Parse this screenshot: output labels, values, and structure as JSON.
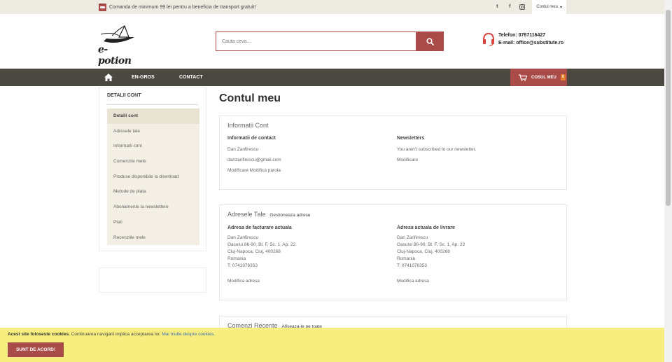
{
  "topbar": {
    "promo_text": "Comanda de minimum 99 lei pentru a beneficia de transport gratuit!",
    "social": [
      "twitter-icon",
      "facebook-icon",
      "instagram-icon"
    ],
    "account_label": "Contul meu"
  },
  "header": {
    "logo_text": "e-potion",
    "search_placeholder": "Cauta ceva...",
    "phone": "Telefon: 0767116427",
    "email": "E-mail: office@substitute.ro"
  },
  "nav": {
    "items": [
      "EN-GROS",
      "CONTACT"
    ],
    "cart_label": "COSUL MEU",
    "cart_count": "0"
  },
  "sidebar": {
    "title": "DETALII CONT",
    "items": [
      "Detalii cont",
      "Adresele tale",
      "Informatii cont",
      "Comenzile mele",
      "Produse disponibile la download",
      "Metode de plata",
      "Abonamente la newslettere",
      "Plati",
      "Recenziile mele"
    ]
  },
  "main": {
    "title": "Contul meu",
    "info": {
      "heading": "Informatii Cont",
      "contact_heading": "Informatii de contact",
      "name": "Dan Zanfirescu",
      "email": "danzanfirescu@gmail.com",
      "edit_links": "Modificare Modifica parola",
      "newsletter_heading": "Newsletters",
      "newsletter_text": "You aren't subscribed to our newsletter.",
      "newsletter_edit": "Modificare"
    },
    "addresses": {
      "heading": "Adresele Tale",
      "manage": "Gestioneaza adrese",
      "billing_heading": "Adresa de facturare actuala",
      "shipping_heading": "Adresa actuala de livrare",
      "billing": [
        "Dan Zanfirescu",
        "Oasului 86-90, Bl. F, Sc. 1, Ap. 22",
        "Cluj-Napoca, Cluj, 400268",
        "Romania",
        "T: 0741076353"
      ],
      "shipping": [
        "Dan Zanfirescu",
        "Oasului 86-90, Bl. F, Sc. 1, Ap. 22",
        "Cluj-Napoca, Cluj, 400268",
        "Romania",
        "T: 0741076353"
      ],
      "billing_edit": "Modifica adresa",
      "shipping_edit": "Modifica adresa"
    },
    "orders": {
      "heading": "Comenzi Recente",
      "view_all": "Afiseaza-le pe toate"
    }
  },
  "cookie": {
    "bold": "Acest site foloseste cookies.",
    "text": " Continuarea navigarii implica acceptarea lor.",
    "link": "Mai multe despre cookies.",
    "button": "SUNT DE ACORD!"
  },
  "colors": {
    "accent": "#a94c49",
    "nav_bg": "#4a4841",
    "topbar_bg": "#eeebe3",
    "cookie_bg": "#f7ee80"
  }
}
